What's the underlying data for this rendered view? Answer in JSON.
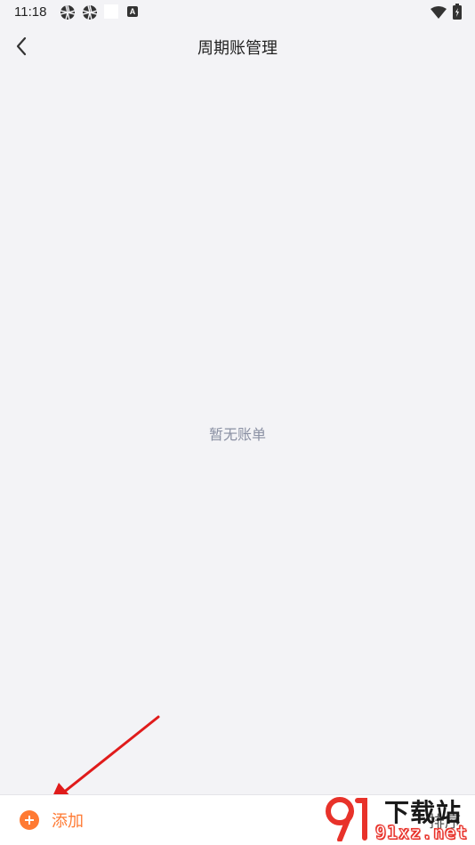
{
  "status_bar": {
    "time": "11:18",
    "icons": [
      "aperture-icon",
      "aperture-icon",
      "blank-notification-icon",
      "a-badge-icon",
      "wifi-icon",
      "battery-icon"
    ],
    "a_badge": "A"
  },
  "header": {
    "title": "周期账管理",
    "back_icon": "chevron-left-icon"
  },
  "main": {
    "empty_text": "暂无账单"
  },
  "bottom_bar": {
    "add_label": "添加",
    "add_icon": "plus-circle-icon",
    "sort_label": "排序",
    "accent_color": "#ff7a33"
  },
  "watermark": {
    "title": "下载站",
    "url": "91xz.net"
  }
}
